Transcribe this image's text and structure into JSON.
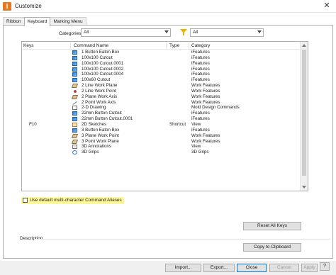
{
  "window": {
    "title": "Customize",
    "app_icon_letter": "I",
    "close_glyph": "✕"
  },
  "tabs": [
    {
      "label": "Ribbon"
    },
    {
      "label": "Keyboard"
    },
    {
      "label": "Marking Menu"
    }
  ],
  "filters": {
    "categories_label": "Categories",
    "categories_value": "All",
    "filter_value": "All"
  },
  "table": {
    "headers": [
      "Keys",
      "Command Name",
      "Type",
      "Category"
    ],
    "rows": [
      {
        "keys": "",
        "icon": "feature-icon",
        "name": "1 Button Eaton Box",
        "type": "",
        "category": "iFeatures"
      },
      {
        "keys": "",
        "icon": "feature-icon",
        "name": "100x100 Cutout",
        "type": "",
        "category": "iFeatures"
      },
      {
        "keys": "",
        "icon": "feature-icon",
        "name": "100x100 Cutout.0001",
        "type": "",
        "category": "iFeatures"
      },
      {
        "keys": "",
        "icon": "feature-icon",
        "name": "100x100 Cutout.0002",
        "type": "",
        "category": "iFeatures"
      },
      {
        "keys": "",
        "icon": "feature-icon",
        "name": "100x100 Cutout.0004",
        "type": "",
        "category": "iFeatures"
      },
      {
        "keys": "",
        "icon": "feature-icon",
        "name": "100x60 Cutout",
        "type": "",
        "category": "iFeatures"
      },
      {
        "keys": "",
        "icon": "plane-icon",
        "name": "2 Line Work Plane",
        "type": "",
        "category": "Work Features"
      },
      {
        "keys": "",
        "icon": "point-icon",
        "name": "2 Line Work Point",
        "type": "",
        "category": "Work Features"
      },
      {
        "keys": "",
        "icon": "plane-icon",
        "name": "2 Plane Work Axis",
        "type": "",
        "category": "Work Features"
      },
      {
        "keys": "",
        "icon": "axis-icon",
        "name": "2 Point Work Axis",
        "type": "",
        "category": "Work Features"
      },
      {
        "keys": "",
        "icon": "drawing-icon",
        "name": "2-D Drawing",
        "type": "",
        "category": "Mold Design Commands"
      },
      {
        "keys": "",
        "icon": "feature-icon",
        "name": "22mm Button Cutout",
        "type": "",
        "category": "iFeatures"
      },
      {
        "keys": "",
        "icon": "feature-icon",
        "name": "22mm Button Cutout.0001",
        "type": "",
        "category": "iFeatures"
      },
      {
        "keys": "F10",
        "icon": "sketch-icon",
        "name": "2D Sketches",
        "type": "Shortcut",
        "category": "View"
      },
      {
        "keys": "",
        "icon": "feature-icon",
        "name": "3 Button Eaton Box",
        "type": "",
        "category": "iFeatures"
      },
      {
        "keys": "",
        "icon": "plane-icon",
        "name": "3 Plane Work Point",
        "type": "",
        "category": "Work Features"
      },
      {
        "keys": "",
        "icon": "plane-icon",
        "name": "3 Point Work Plane",
        "type": "",
        "category": "Work Features"
      },
      {
        "keys": "",
        "icon": "annotation-icon",
        "name": "3D Annotations",
        "type": "",
        "category": "View"
      },
      {
        "keys": "",
        "icon": "grip-icon",
        "name": "3D Grips",
        "type": "",
        "category": "3D Grips"
      }
    ]
  },
  "checkbox": {
    "label": "Use default multi-character Command Aliases",
    "checked": false
  },
  "buttons": {
    "reset_all_keys": "Reset All Keys",
    "copy_to_clipboard": "Copy to Clipboard",
    "import": "Import...",
    "export": "Export...",
    "close": "Close",
    "cancel": "Cancel",
    "apply": "Apply",
    "help": "?"
  },
  "description_label": "Description"
}
